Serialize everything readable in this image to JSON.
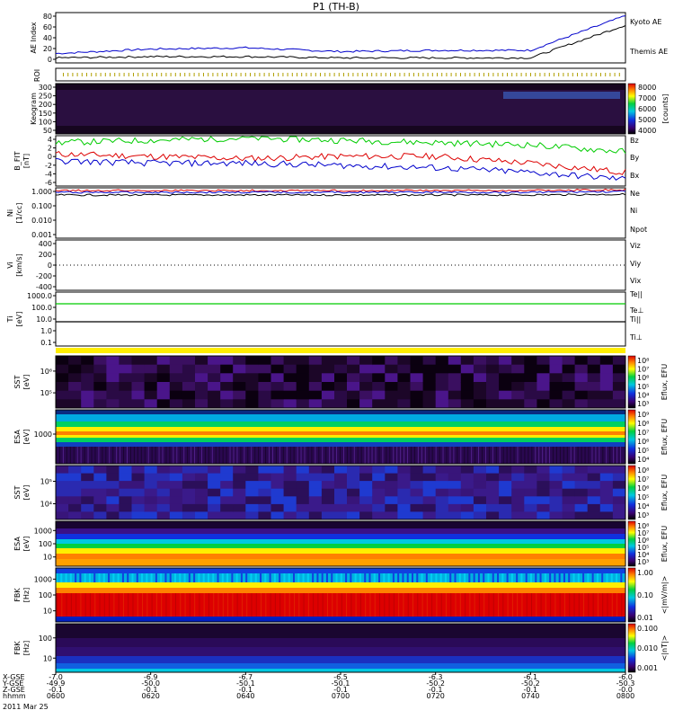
{
  "title": "P1 (TH-B)",
  "xaxis": {
    "row_labels": [
      "X-GSE",
      "Y-GSE",
      "Z-GSE",
      "hhmm",
      "2011 Mar 25"
    ],
    "ticks": [
      {
        "xgse": "-7.0",
        "ygse": "-49.9",
        "zgse": "-0.1",
        "time": "0600"
      },
      {
        "xgse": "-6.9",
        "ygse": "-50.0",
        "zgse": "-0.1",
        "time": "0620"
      },
      {
        "xgse": "-6.7",
        "ygse": "-50.1",
        "zgse": "-0.1",
        "time": "0640"
      },
      {
        "xgse": "-6.5",
        "ygse": "-50.1",
        "zgse": "-0.1",
        "time": "0700"
      },
      {
        "xgse": "-6.3",
        "ygse": "-50.2",
        "zgse": "-0.1",
        "time": "0720"
      },
      {
        "xgse": "-6.1",
        "ygse": "-50.2",
        "zgse": "-0.1",
        "time": "0740"
      },
      {
        "xgse": "-6.0",
        "ygse": "-50.3",
        "zgse": "-0.0",
        "time": "0800"
      }
    ]
  },
  "chart_data": [
    {
      "type": "line",
      "id": "ae",
      "ylabel": "AE Index",
      "ylim": [
        0,
        80
      ],
      "yticks": [
        "0",
        "20",
        "40",
        "60",
        "80"
      ],
      "x": [
        "0600",
        "0620",
        "0640",
        "0700",
        "0720",
        "0740",
        "0800"
      ],
      "series": [
        {
          "name": "Kyoto AE",
          "color": "#0000cc",
          "values": [
            15,
            22,
            24,
            18,
            20,
            20,
            75
          ]
        },
        {
          "name": "Themis AE",
          "color": "#000000",
          "values": [
            8,
            10,
            10,
            8,
            8,
            8,
            60
          ]
        }
      ]
    },
    {
      "type": "table",
      "id": "roi",
      "ylabel": "ROI"
    },
    {
      "type": "heatmap",
      "id": "keogram",
      "ylabel": "Keogram",
      "yticks": [
        "300",
        "250",
        "200",
        "150",
        "100",
        "50"
      ],
      "colorbar": {
        "label": "[counts]",
        "ticks": [
          "8000",
          "7000",
          "6000",
          "5000",
          "4000"
        ]
      }
    },
    {
      "type": "line",
      "id": "bfit",
      "ylabel": "B_FIT",
      "yunit": "[nT]",
      "ylim": [
        -6,
        5
      ],
      "yticks": [
        "4",
        "2",
        "0",
        "-2",
        "-4",
        "-6"
      ],
      "x": [
        "0600",
        "0620",
        "0640",
        "0700",
        "0720",
        "0740",
        "0800"
      ],
      "series": [
        {
          "name": "Bz",
          "color": "#dd0000",
          "values": [
            1,
            0.5,
            0,
            0.5,
            0.5,
            -1,
            -3
          ]
        },
        {
          "name": "By",
          "color": "#00cc00",
          "values": [
            3.5,
            4,
            4.5,
            4,
            3.5,
            3,
            1.5
          ]
        },
        {
          "name": "Bx",
          "color": "#0000cc",
          "values": [
            -0.5,
            -1,
            -1,
            -1.5,
            -2,
            -3,
            -4.5
          ]
        }
      ]
    },
    {
      "type": "line",
      "id": "ni",
      "ylabel": "Ni",
      "yunit": "[1/cc]",
      "yticks": [
        "1.000",
        "0.100",
        "0.010",
        "0.001"
      ],
      "x": [
        "0600",
        "0620",
        "0640",
        "0700",
        "0720",
        "0740",
        "0800"
      ],
      "series": [
        {
          "name": "Ne",
          "color": "#dd0000",
          "values": [
            1.4,
            1.4,
            1.4,
            1.4,
            1.4,
            1.5,
            1.6
          ]
        },
        {
          "name": "Ni",
          "color": "#000000",
          "values": [
            1.1,
            1.1,
            1.1,
            1.1,
            1.1,
            1.2,
            1.3
          ]
        },
        {
          "name": "Npot",
          "color": "#0000cc",
          "values": [
            1.2,
            1.2,
            1.2,
            1.2,
            1.2,
            1.3,
            1.4
          ]
        }
      ]
    },
    {
      "type": "line",
      "id": "vi",
      "ylabel": "Vi",
      "yunit": "[km/s]",
      "ylim": [
        -500,
        500
      ],
      "yticks": [
        "400",
        "200",
        "0",
        "-200",
        "-400"
      ],
      "x": [
        "0600",
        "0620",
        "0640",
        "0700",
        "0720",
        "0740",
        "0800"
      ],
      "series": [
        {
          "name": "Viz",
          "color": "#dd0000",
          "values": [
            0,
            0,
            0,
            0,
            0,
            0,
            0
          ]
        },
        {
          "name": "Viy",
          "color": "#00cc00",
          "values": [
            0,
            0,
            0,
            0,
            0,
            0,
            0
          ]
        },
        {
          "name": "Vix",
          "color": "#0000cc",
          "values": [
            0,
            0,
            0,
            0,
            0,
            0,
            0
          ]
        }
      ]
    },
    {
      "type": "line",
      "id": "ti",
      "ylabel": "Ti",
      "yunit": "[eV]",
      "yticks": [
        "1000.0",
        "100.0",
        "10.0",
        "1.0",
        "0.1"
      ],
      "x": [
        "0600",
        "0620",
        "0640",
        "0700",
        "0720",
        "0740",
        "0800"
      ],
      "series": [
        {
          "name": "Te||",
          "color": "#000000",
          "values": [
            900,
            900,
            900,
            900,
            900,
            900,
            900
          ]
        },
        {
          "name": "Te⊥",
          "color": "#dd0000",
          "values": [
            900,
            900,
            900,
            900,
            900,
            900,
            900
          ]
        },
        {
          "name": "Ti||",
          "color": "#00cc00",
          "values": [
            900,
            900,
            900,
            900,
            900,
            900,
            900
          ]
        },
        {
          "name": "Ti⊥",
          "color": "#0000cc",
          "values": [
            8,
            8,
            8,
            8,
            8,
            8,
            8
          ]
        }
      ]
    },
    {
      "type": "heatmap",
      "id": "sst_e",
      "ylabel": "SST",
      "yunit": "[eV]",
      "yticks": [
        "10⁶",
        "10⁵"
      ],
      "colorbar": {
        "label": "Eflux, EFU",
        "ticks": [
          "10⁸",
          "10⁷",
          "10⁶",
          "10⁵",
          "10⁴",
          "10³"
        ]
      }
    },
    {
      "type": "heatmap",
      "id": "esa_e",
      "ylabel": "ESA",
      "yunit": "[eV]",
      "yticks": [
        "1000"
      ],
      "colorbar": {
        "label": "Eflux, EFU",
        "ticks": [
          "10⁹",
          "10⁸",
          "10⁷",
          "10⁶",
          "10⁵",
          "10⁴"
        ]
      }
    },
    {
      "type": "heatmap",
      "id": "sst_i",
      "ylabel": "SST",
      "yunit": "[eV]",
      "yticks": [
        "10⁵",
        "10⁴"
      ],
      "colorbar": {
        "label": "Eflux, EFU",
        "ticks": [
          "10⁸",
          "10⁷",
          "10⁶",
          "10⁵",
          "10⁴",
          "10³"
        ]
      }
    },
    {
      "type": "heatmap",
      "id": "esa_i",
      "ylabel": "ESA",
      "yunit": "[eV]",
      "yticks": [
        "1000",
        "100",
        "10"
      ],
      "colorbar": {
        "label": "Eflux, EFU",
        "ticks": [
          "10⁸",
          "10⁷",
          "10⁶",
          "10⁵",
          "10⁴",
          "10³"
        ]
      }
    },
    {
      "type": "heatmap",
      "id": "fbk_e",
      "ylabel": "FBK",
      "yunit": "[Hz]",
      "yticks": [
        "1000",
        "100",
        "10"
      ],
      "colorbar": {
        "label": "<|mV/m|>",
        "ticks": [
          "1.00",
          "0.10",
          "0.01"
        ]
      }
    },
    {
      "type": "heatmap",
      "id": "fbk_b",
      "ylabel": "FBK",
      "yunit": "[Hz]",
      "yticks": [
        "100",
        "10"
      ],
      "colorbar": {
        "label": "<|nT|>",
        "ticks": [
          "0.100",
          "0.010",
          "0.001"
        ]
      }
    }
  ],
  "colors": {
    "green": "#00cc00",
    "red": "#dd0000",
    "blue": "#0000cc",
    "darkbg": "#1a0a2e",
    "yellow": "#ffee00"
  }
}
